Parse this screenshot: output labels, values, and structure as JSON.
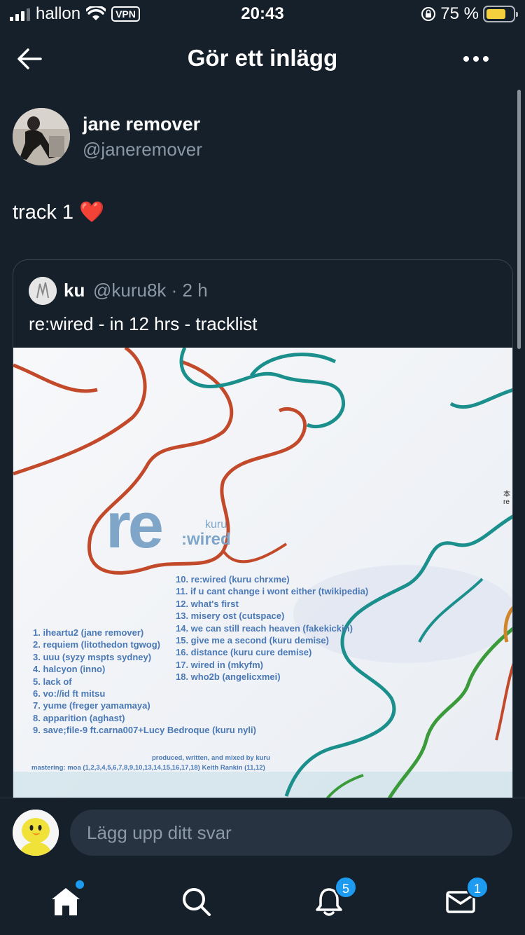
{
  "status_bar": {
    "carrier": "hallon",
    "vpn": "VPN",
    "time": "20:43",
    "battery": "75 %",
    "battery_level": 0.75,
    "icons": [
      "signal-icon",
      "wifi-icon",
      "rotation-lock-icon",
      "battery-icon"
    ]
  },
  "header": {
    "title": "Gör ett inlägg",
    "icons": [
      "back-arrow-icon",
      "more-icon"
    ]
  },
  "post": {
    "author_name": "jane remover",
    "author_handle": "@janeremover",
    "text": "track 1 ❤️"
  },
  "quote": {
    "author_name": "ku",
    "author_meta": "@kuru8k · 2 h",
    "text": "re:wired - in 12 hrs - tracklist",
    "album": {
      "logo_re": "re",
      "logo_kuru": "kuru",
      "logo_wired": ":wired",
      "side_text": "本\nre",
      "tracks_left": [
        "1. iheartu2 (jane remover)",
        "2. requiem (litothedon tgwog)",
        "3. uuu (syzy mspts sydney)",
        "4. halcyon (inno)",
        "5. lack of",
        "6. vo://id ft mitsu",
        "7. yume (freger yamamaya)",
        "8. apparition (aghast)",
        "9. save;file-9 ft.carna007+Lucy Bedroque (kuru nyli)"
      ],
      "tracks_right": [
        "10. re:wired (kuru chrxme)",
        "11. if u cant change i wont either (twikipedia)",
        "12. what's first",
        "13. misery ost (cutspace)",
        "14. we can still reach heaven (fakekickin)",
        "15. give me a second (kuru demise)",
        "16. distance (kuru cure demise)",
        "17. wired in (mkyfm)",
        "18. who2b (angelicxmei)"
      ],
      "credit_produced": "produced, written, and mixed by kuru",
      "credit_mastering": "mastering: moa (1,2,3,4,5,6,7,8,9,10,13,14,15,16,17,18)   Keith Rankin (11,12)"
    }
  },
  "reply": {
    "placeholder": "Lägg upp ditt svar"
  },
  "tabbar": {
    "notifications_badge": "5",
    "messages_badge": "1",
    "icons": [
      "home-icon",
      "search-icon",
      "bell-icon",
      "mail-icon"
    ]
  },
  "colors": {
    "background": "#15202b",
    "accent": "#1d9bf0",
    "muted_text": "#8b98a5",
    "album_blue": "#7fa6c9"
  }
}
